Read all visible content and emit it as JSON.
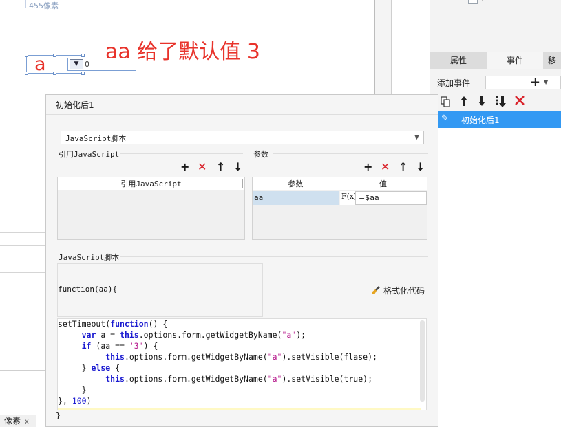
{
  "canvas": {
    "px_hint": "455像素",
    "annotation": "aa  给了默认值 3",
    "widget_label": "a",
    "widget_combo_value": "0"
  },
  "bottom_tab": {
    "label": "像素",
    "close": "x"
  },
  "right_panel": {
    "checkbox_label": "c",
    "tabs": [
      "属性",
      "事件",
      "移"
    ],
    "add_event_label": "添加事件",
    "add_event_plus": "+",
    "add_event_caret": "▼",
    "toolbar_icons": [
      "copy-icon",
      "arrow-up-icon",
      "arrow-down-icon",
      "move-to-bottom-icon",
      "delete-icon"
    ],
    "event_items": [
      {
        "label": "初始化后1",
        "icon": "edit-icon"
      }
    ]
  },
  "dialog": {
    "title": "初始化后1",
    "type_select": {
      "value": "JavaScript脚本",
      "arrow": "▼"
    },
    "ref_section": {
      "label": "引用JavaScript",
      "column": "引用JavaScript",
      "toolbar": [
        "+",
        "✕",
        "↑",
        "↓"
      ]
    },
    "param_section": {
      "label": "参数",
      "columns": [
        "参数",
        "值"
      ],
      "rows": [
        {
          "name": "aa",
          "formula_icon": "F(x)",
          "value": "=$aa"
        }
      ],
      "toolbar": [
        "+",
        "✕",
        "↑",
        "↓"
      ]
    },
    "script_section": {
      "label": "JavaScript脚本",
      "signature": "function(aa){",
      "format_button": "格式化代码",
      "code_lines": [
        "setTimeout(function() {",
        "     var a = this.options.form.getWidgetByName(\"a\");",
        "     if (aa == '3') {",
        "          this.options.form.getWidgetByName(\"a\").setVisible(flase);",
        "     } else {",
        "          this.options.form.getWidgetByName(\"a\").setVisible(true);",
        "     }",
        "}, 100)"
      ],
      "closing": "}"
    }
  },
  "colors": {
    "annotation_red": "#e8332b",
    "selection_blue": "#3399f3",
    "delete_red": "#d9232b",
    "param_row_highlight": "#cfe0ef",
    "keyword_blue": "#1a1ad0",
    "string_magenta": "#b5158a"
  }
}
